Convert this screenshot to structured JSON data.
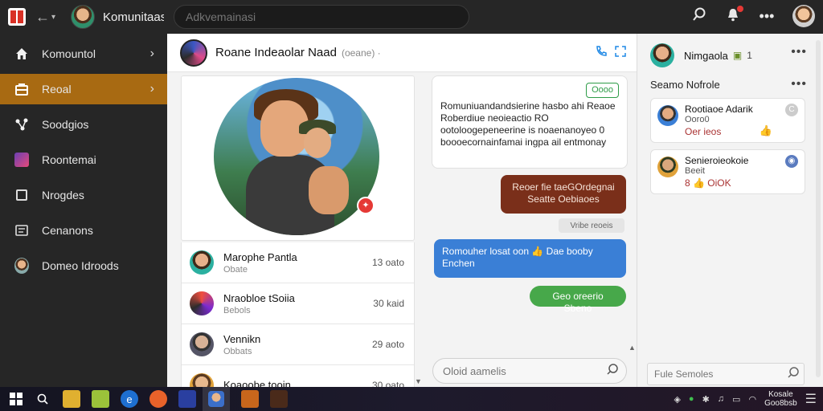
{
  "topbar": {
    "app_title": "Komunitaas",
    "search_placeholder": "Adkvemainasi"
  },
  "sidebar": {
    "items": [
      {
        "label": "Komountol",
        "icon": "home-icon",
        "active": false,
        "chevron": "›"
      },
      {
        "label": "Reoal",
        "icon": "inbox-icon",
        "active": true,
        "chevron": "›"
      },
      {
        "label": "Soodgios",
        "icon": "share-nodes-icon",
        "active": false
      },
      {
        "label": "Roontemai",
        "icon": "image-icon",
        "active": false
      },
      {
        "label": "Nrogdes",
        "icon": "square-icon",
        "active": false
      },
      {
        "label": "Cenanons",
        "icon": "document-icon",
        "active": false
      },
      {
        "label": "Domeo Idroods",
        "icon": "avatar-icon",
        "active": false
      }
    ]
  },
  "chat": {
    "header_name": "Roane Indeaolar Naad",
    "header_sub": "(oeane) ·",
    "contacts": [
      {
        "name": "Marophe Pantla",
        "sub": "Obate",
        "time": "13 oato"
      },
      {
        "name": "Nraobloe tSoiia",
        "sub": "Bebols",
        "time": "30 kaid"
      },
      {
        "name": "Vennikn",
        "sub": "Obbats",
        "time": "29 aoto"
      },
      {
        "name": "Koaoobe tooin",
        "sub": "",
        "time": "30 oato"
      }
    ],
    "messages": {
      "incoming_tag": "Oooo",
      "incoming_text": "Romuniuandandsierine hasbo ahi Reaoe Roberdiue neoieactio RO ootoloogepeneerine is noaenanoyeo 0 boooecornainfamai ingpa ail entmonay",
      "brown_text": "Reoer fie taeGOrdegnai Seatte Oebiaoes",
      "system_text": "Vribe reoeis",
      "blue_text": "Romouher losat oon 👍 Dae booby Enchen",
      "green_text": "Geo oreerio Sbeno"
    },
    "compose_placeholder": "Oloid aamelis"
  },
  "right_panel": {
    "user_name": "Nimgaola",
    "user_badge": "1",
    "section_title": "Seamo Nofrole",
    "cards": [
      {
        "title": "Rootiaoe Adarik",
        "sub": "Ooro0",
        "value": "Oer ieos",
        "badge": "C"
      },
      {
        "title": "Senieroieokoie",
        "sub": "Beeit",
        "value": "8 👍 OiOK",
        "badge": ""
      }
    ],
    "search_placeholder": "Fule Semoles"
  },
  "taskbar": {
    "clock_line1": "Kosale",
    "clock_line2": "Goo8bsb"
  },
  "colors": {
    "accent": "#a86a12",
    "brown_bubble": "#7a2f1a",
    "blue_bubble": "#3a7fd6",
    "green_bubble": "#47a84a"
  }
}
